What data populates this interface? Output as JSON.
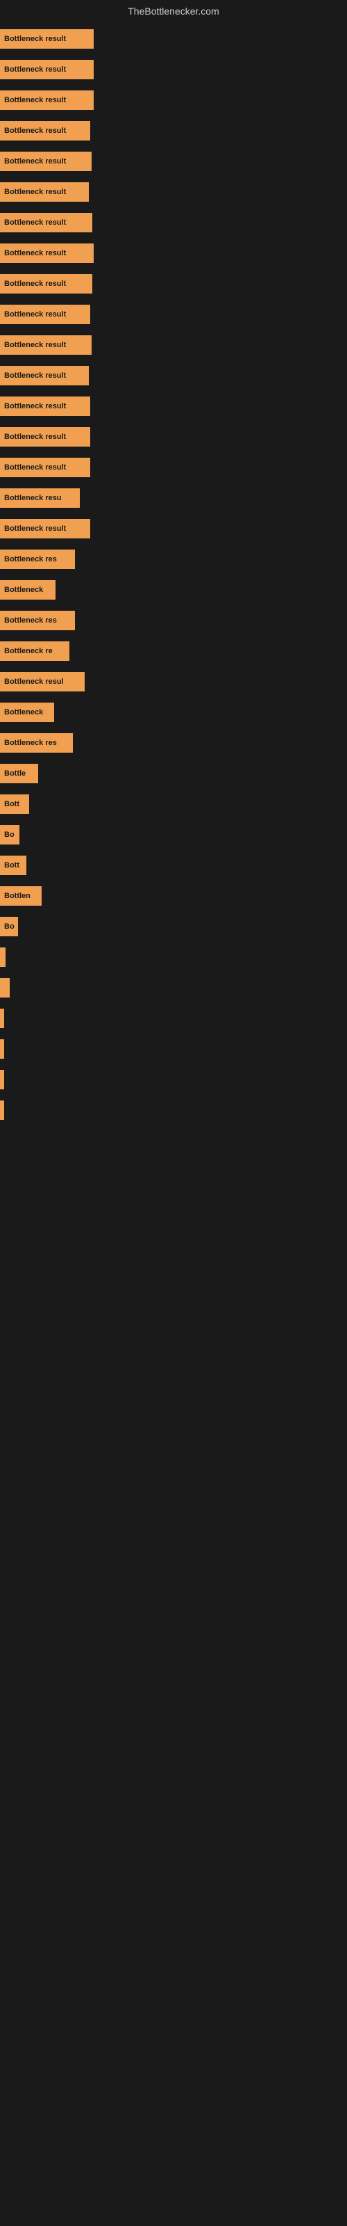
{
  "header": {
    "title": "TheBottlenecker.com"
  },
  "bars": [
    {
      "label": "Bottleneck result",
      "width": 135,
      "id": "bar-1"
    },
    {
      "label": "Bottleneck result",
      "width": 135,
      "id": "bar-2"
    },
    {
      "label": "Bottleneck result",
      "width": 135,
      "id": "bar-3"
    },
    {
      "label": "Bottleneck result",
      "width": 130,
      "id": "bar-4"
    },
    {
      "label": "Bottleneck result",
      "width": 132,
      "id": "bar-5"
    },
    {
      "label": "Bottleneck result",
      "width": 128,
      "id": "bar-6"
    },
    {
      "label": "Bottleneck result",
      "width": 133,
      "id": "bar-7"
    },
    {
      "label": "Bottleneck result",
      "width": 135,
      "id": "bar-8"
    },
    {
      "label": "Bottleneck result",
      "width": 133,
      "id": "bar-9"
    },
    {
      "label": "Bottleneck result",
      "width": 130,
      "id": "bar-10"
    },
    {
      "label": "Bottleneck result",
      "width": 132,
      "id": "bar-11"
    },
    {
      "label": "Bottleneck result",
      "width": 128,
      "id": "bar-12"
    },
    {
      "label": "Bottleneck result",
      "width": 130,
      "id": "bar-13"
    },
    {
      "label": "Bottleneck result",
      "width": 130,
      "id": "bar-14"
    },
    {
      "label": "Bottleneck result",
      "width": 130,
      "id": "bar-15"
    },
    {
      "label": "Bottleneck resu",
      "width": 115,
      "id": "bar-16"
    },
    {
      "label": "Bottleneck result",
      "width": 130,
      "id": "bar-17"
    },
    {
      "label": "Bottleneck res",
      "width": 108,
      "id": "bar-18"
    },
    {
      "label": "Bottleneck",
      "width": 80,
      "id": "bar-19"
    },
    {
      "label": "Bottleneck res",
      "width": 108,
      "id": "bar-20"
    },
    {
      "label": "Bottleneck re",
      "width": 100,
      "id": "bar-21"
    },
    {
      "label": "Bottleneck resul",
      "width": 122,
      "id": "bar-22"
    },
    {
      "label": "Bottleneck",
      "width": 78,
      "id": "bar-23"
    },
    {
      "label": "Bottleneck res",
      "width": 105,
      "id": "bar-24"
    },
    {
      "label": "Bottle",
      "width": 55,
      "id": "bar-25"
    },
    {
      "label": "Bott",
      "width": 42,
      "id": "bar-26"
    },
    {
      "label": "Bo",
      "width": 28,
      "id": "bar-27"
    },
    {
      "label": "Bott",
      "width": 38,
      "id": "bar-28"
    },
    {
      "label": "Bottlen",
      "width": 60,
      "id": "bar-29"
    },
    {
      "label": "Bo",
      "width": 26,
      "id": "bar-30"
    },
    {
      "label": "",
      "width": 8,
      "id": "bar-31"
    },
    {
      "label": "",
      "width": 14,
      "id": "bar-32"
    },
    {
      "label": "",
      "width": 6,
      "id": "bar-33"
    },
    {
      "label": "",
      "width": 4,
      "id": "bar-34"
    },
    {
      "label": "",
      "width": 4,
      "id": "bar-35"
    },
    {
      "label": "",
      "width": 4,
      "id": "bar-36"
    }
  ]
}
